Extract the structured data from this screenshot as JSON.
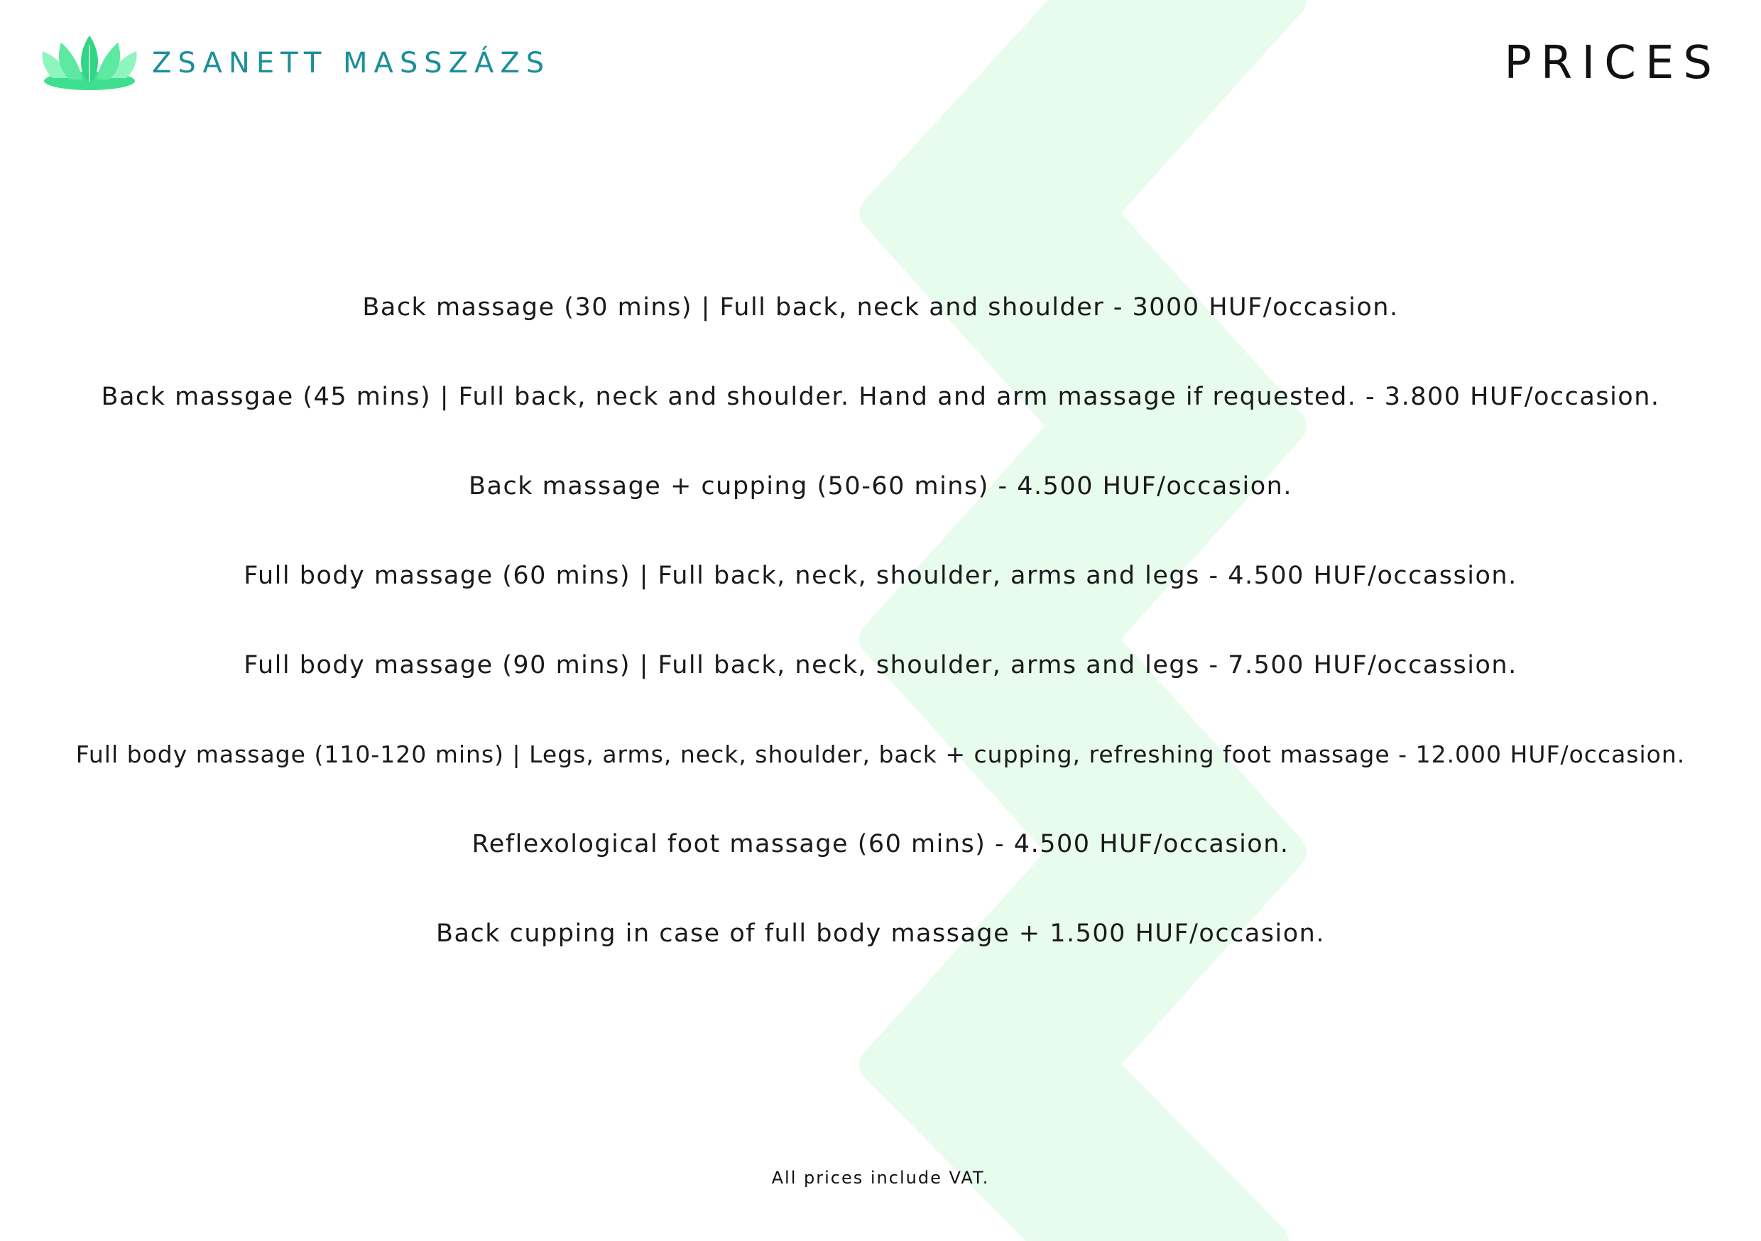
{
  "brand": {
    "name": "ZSANETT MASSZÁZS",
    "logo_icon": "lotus-icon",
    "colors": {
      "accent": "#1a8f9a",
      "logo_light": "#7ef3b6",
      "logo_dark": "#2fd684",
      "background_zigzag": "#e8fcee"
    }
  },
  "header": {
    "title": "PRICES"
  },
  "prices": [
    "Back massage (30 mins) | Full back, neck and shoulder - 3000 HUF/occasion.",
    "Back massgae (45 mins) | Full back, neck and shoulder. Hand and arm massage if requested. - 3.800 HUF/occasion.",
    "Back massage + cupping (50-60 mins) - 4.500 HUF/occasion.",
    "Full body massage (60 mins) | Full back, neck, shoulder, arms and legs - 4.500 HUF/occassion.",
    "Full body massage (90 mins) | Full back, neck, shoulder, arms and legs - 7.500 HUF/occassion.",
    "Full body massage (110-120 mins) | Legs, arms, neck, shoulder, back + cupping, refreshing foot massage - 12.000 HUF/occasion.",
    "Reflexological foot massage (60 mins) - 4.500 HUF/occasion.",
    "Back cupping in case of full body massage + 1.500 HUF/occasion."
  ],
  "footer": {
    "note": "All prices include VAT."
  }
}
